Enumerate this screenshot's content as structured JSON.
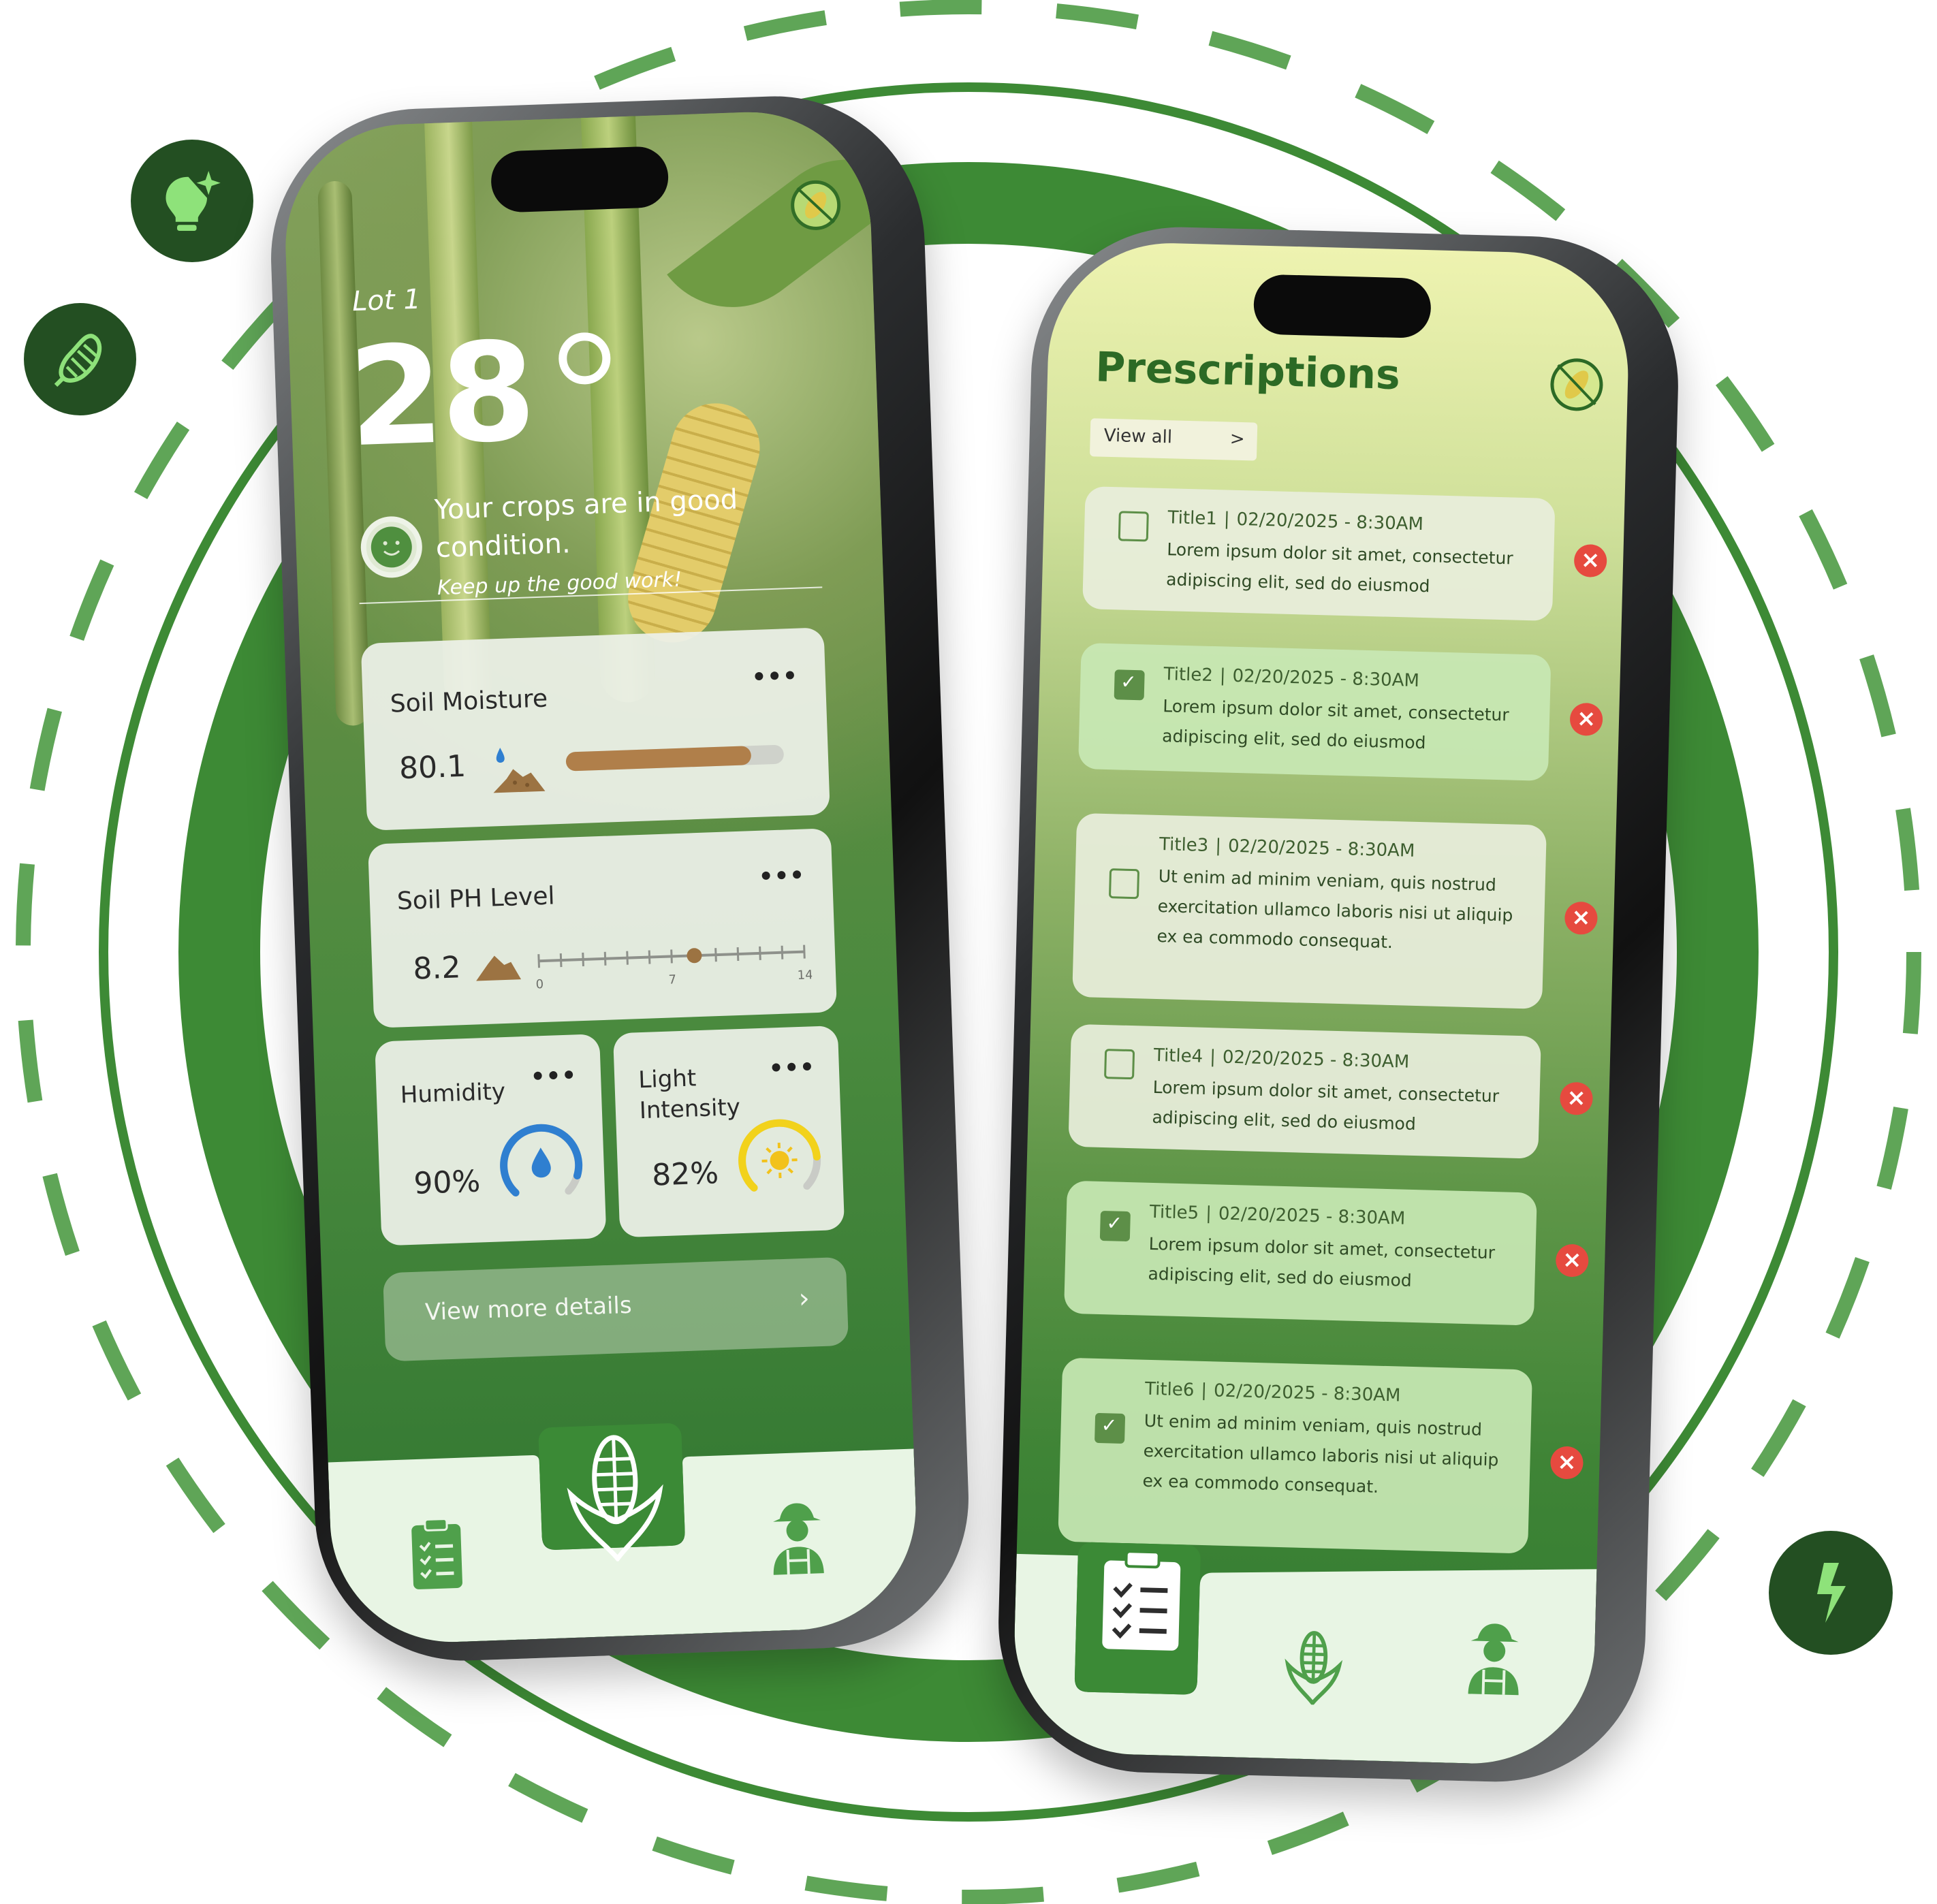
{
  "colors": {
    "ring_green": "#3d8a35",
    "dash_green": "#5fa557",
    "badge_dark": "#234f22",
    "badge_icon": "#8ee27a",
    "accent_green": "#2c6a25",
    "close_red": "#e64a3f"
  },
  "badges": [
    {
      "icon": "lightbulb-sparkle-icon"
    },
    {
      "icon": "corn-icon"
    },
    {
      "icon": "lightning-icon"
    }
  ],
  "dashboard": {
    "lot": "Lot 1",
    "temperature": "28",
    "status_title": "Your crops are in good condition.",
    "status_subtitle": "Keep up the good work!",
    "more_menu": "•••",
    "soil_moisture": {
      "title": "Soil Moisture",
      "value": "80.1",
      "fill_percent": 85
    },
    "soil_ph": {
      "title": "Soil PH Level",
      "value": "8.2",
      "scale": [
        "0",
        "7",
        "14"
      ],
      "marker_value": 8.2
    },
    "humidity": {
      "title": "Humidity",
      "value": "90%",
      "level": 0.9
    },
    "light": {
      "title": "Light Intensity",
      "title_line1": "Light",
      "title_line2": "Intensity",
      "value": "82%",
      "level": 0.82
    },
    "details_button": "View more details",
    "details_chevron": "›",
    "nav": [
      "clipboard-icon",
      "corn-icon",
      "farmer-icon"
    ],
    "nav_active": "corn-icon"
  },
  "prescriptions": {
    "title": "Prescriptions",
    "view_all": "View all",
    "view_all_chevron": ">",
    "items": [
      {
        "title": "Title1",
        "date": "02/20/2025 - 8:30AM",
        "body": "Lorem ipsum dolor sit amet, consectetur adipiscing elit, sed do eiusmod",
        "checked": false
      },
      {
        "title": "Title2",
        "date": "02/20/2025 - 8:30AM",
        "body": "Lorem ipsum dolor sit amet, consectetur adipiscing elit, sed do eiusmod",
        "checked": true
      },
      {
        "title": "Title3",
        "date": "02/20/2025 - 8:30AM",
        "body": "Ut enim ad minim veniam, quis nostrud exercitation ullamco laboris nisi ut aliquip ex ea commodo consequat.",
        "checked": false
      },
      {
        "title": "Title4",
        "date": "02/20/2025 - 8:30AM",
        "body": "Lorem ipsum dolor sit amet, consectetur adipiscing elit, sed do eiusmod",
        "checked": false
      },
      {
        "title": "Title5",
        "date": "02/20/2025 - 8:30AM",
        "body": "Lorem ipsum dolor sit amet, consectetur adipiscing elit, sed do eiusmod",
        "checked": true
      },
      {
        "title": "Title6",
        "date": "02/20/2025 - 8:30AM",
        "body": "Ut enim ad minim veniam, quis nostrud exercitation ullamco laboris nisi ut aliquip ex ea commodo consequat.",
        "checked": true
      }
    ],
    "separator": "|",
    "close": "×",
    "check": "✓",
    "nav": [
      "clipboard-icon",
      "corn-icon",
      "farmer-icon"
    ],
    "nav_active": "clipboard-icon"
  }
}
